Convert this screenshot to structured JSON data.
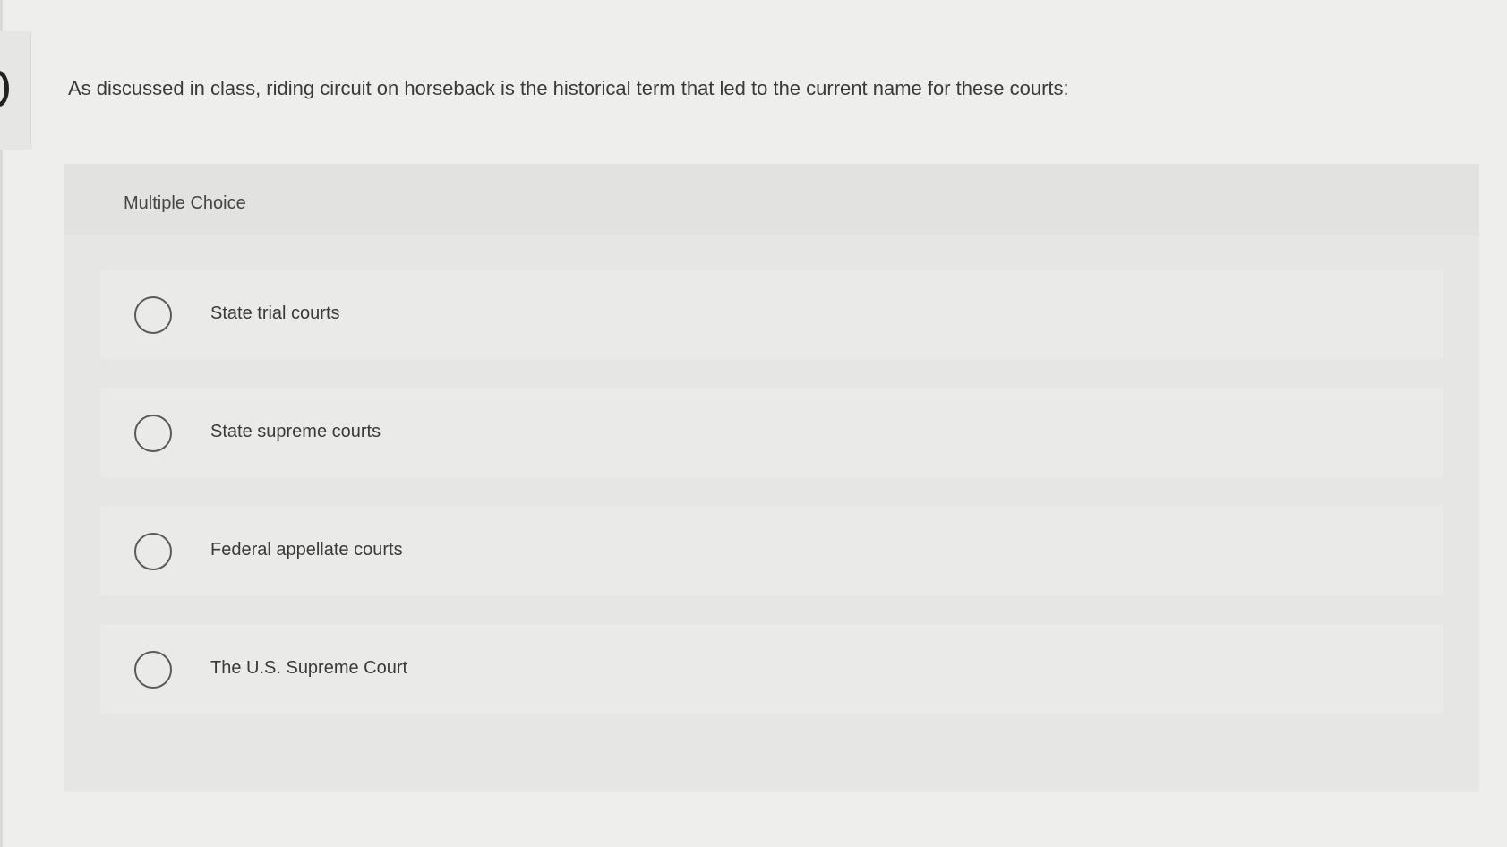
{
  "question": {
    "text": "As discussed in class, riding circuit on horseback is the historical term that led to the current name for these courts:"
  },
  "multiple_choice": {
    "label": "Multiple Choice",
    "options": [
      {
        "label": "State trial courts",
        "selected": false
      },
      {
        "label": "State supreme courts",
        "selected": false
      },
      {
        "label": "Federal appellate courts",
        "selected": false
      },
      {
        "label": "The U.S. Supreme Court",
        "selected": false
      }
    ]
  },
  "colors": {
    "background": "#eeeeec",
    "panel": "#e6e6e4",
    "option_row": "#eaeae8",
    "text": "#3a3a3a",
    "radio_border": "#5a5a5a"
  },
  "icons": {
    "left_marker": "partial-circle-icon",
    "radio": "radio-unselected-icon"
  }
}
